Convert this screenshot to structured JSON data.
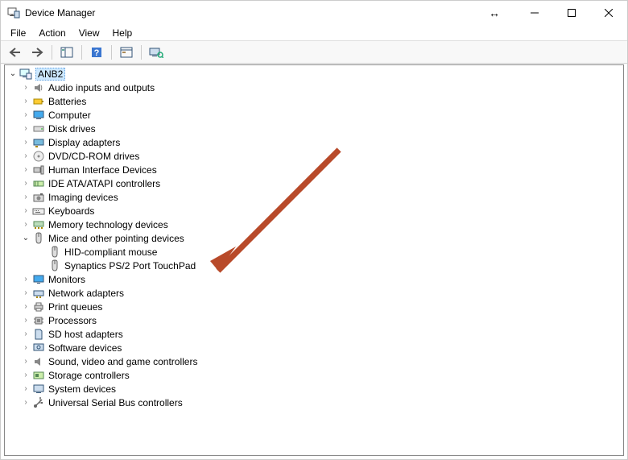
{
  "window": {
    "title": "Device Manager"
  },
  "menu": {
    "file": "File",
    "action": "Action",
    "view": "View",
    "help": "Help"
  },
  "tree": {
    "root": "ANB2",
    "categories": [
      "Audio inputs and outputs",
      "Batteries",
      "Computer",
      "Disk drives",
      "Display adapters",
      "DVD/CD-ROM drives",
      "Human Interface Devices",
      "IDE ATA/ATAPI controllers",
      "Imaging devices",
      "Keyboards",
      "Memory technology devices",
      "Mice and other pointing devices",
      "Monitors",
      "Network adapters",
      "Print queues",
      "Processors",
      "SD host adapters",
      "Software devices",
      "Sound, video and game controllers",
      "Storage controllers",
      "System devices",
      "Universal Serial Bus controllers"
    ],
    "mice_children": [
      "HID-compliant mouse",
      "Synaptics PS/2 Port TouchPad"
    ]
  },
  "annotation": {
    "arrow_color": "#b84a2a"
  }
}
